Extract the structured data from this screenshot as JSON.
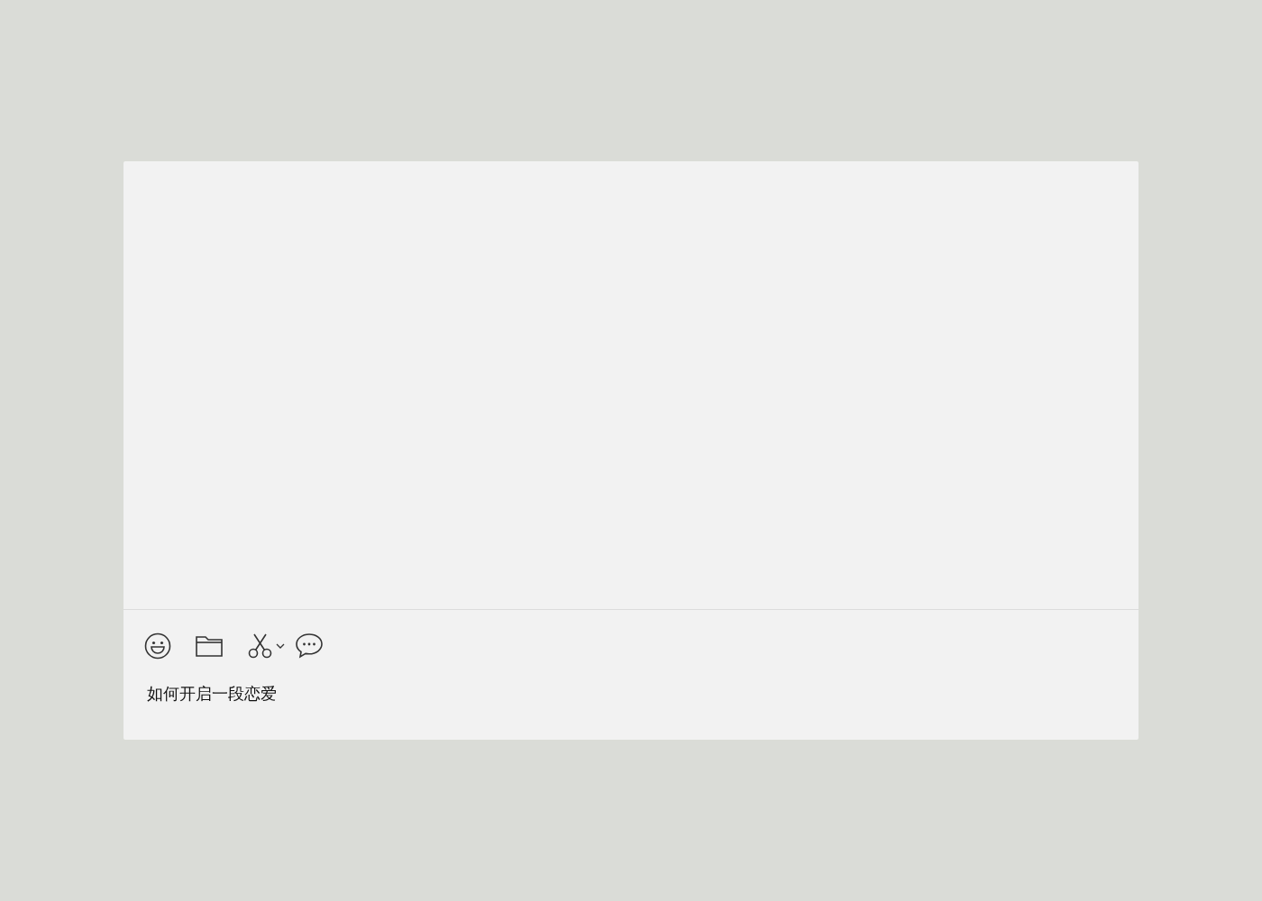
{
  "composer": {
    "value": "如何开启一段恋爱"
  }
}
